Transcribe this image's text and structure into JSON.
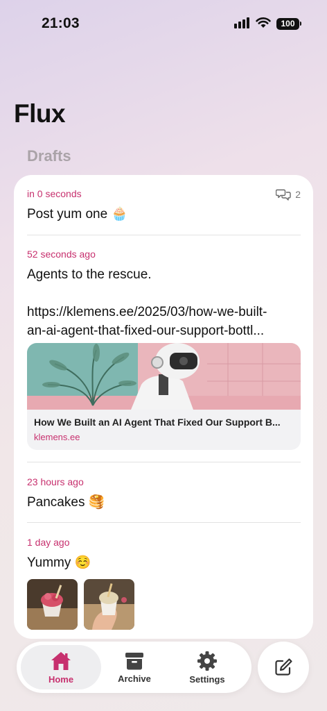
{
  "status_bar": {
    "time": "21:03",
    "battery": "100"
  },
  "header": {
    "title": "Flux",
    "section": "Drafts"
  },
  "posts": [
    {
      "time": "in 0 seconds",
      "text": "Post yum one 🧁",
      "comments": "2"
    },
    {
      "time": "52 seconds ago",
      "text_line1": "Agents to the rescue.",
      "text_line2": "https://klemens.ee/2025/03/how-we-built-",
      "text_line3": "an-ai-agent-that-fixed-our-support-bottl...",
      "link_preview": {
        "title": "How We Built an AI Agent That Fixed Our Support B...",
        "domain": "klemens.ee"
      }
    },
    {
      "time": "23 hours ago",
      "text": "Pancakes 🥞"
    },
    {
      "time": "1 day ago",
      "text": "Yummy ☺️"
    }
  ],
  "tabbar": {
    "items": [
      {
        "label": "Home",
        "icon": "home-icon",
        "active": true
      },
      {
        "label": "Archive",
        "icon": "archive-icon",
        "active": false
      },
      {
        "label": "Settings",
        "icon": "gear-icon",
        "active": false
      }
    ]
  },
  "compose": {
    "icon": "compose-icon"
  },
  "colors": {
    "accent": "#c7306e",
    "background": "#efe6ec"
  }
}
